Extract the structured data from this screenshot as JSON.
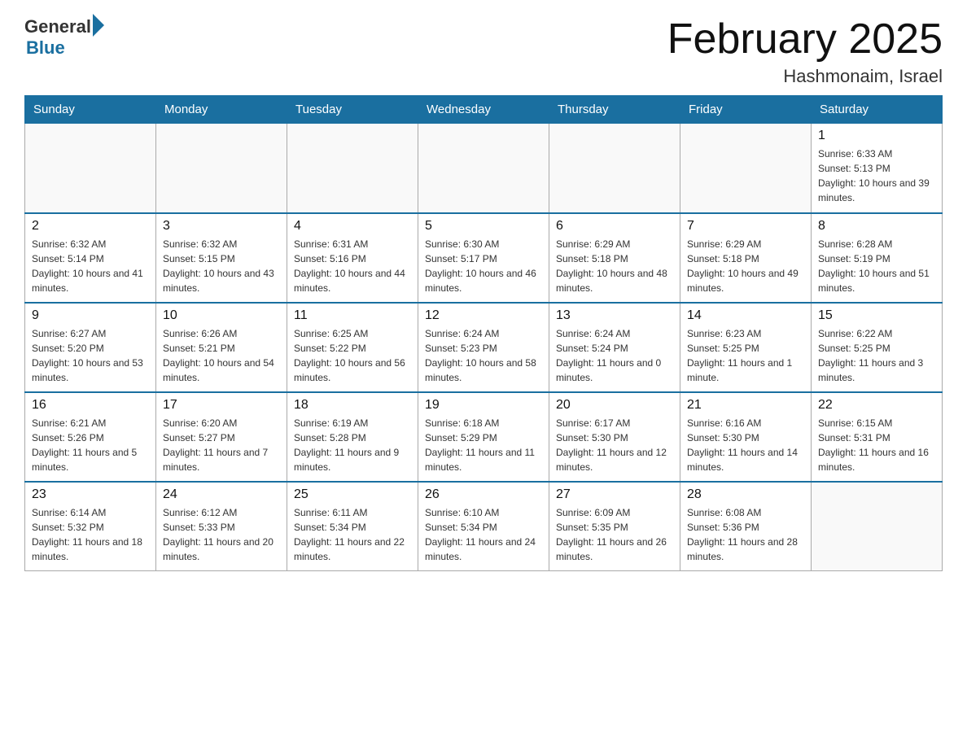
{
  "header": {
    "logo_general": "General",
    "logo_blue": "Blue",
    "month_title": "February 2025",
    "location": "Hashmonaim, Israel"
  },
  "weekdays": [
    "Sunday",
    "Monday",
    "Tuesday",
    "Wednesday",
    "Thursday",
    "Friday",
    "Saturday"
  ],
  "weeks": [
    [
      {
        "day": "",
        "sunrise": "",
        "sunset": "",
        "daylight": ""
      },
      {
        "day": "",
        "sunrise": "",
        "sunset": "",
        "daylight": ""
      },
      {
        "day": "",
        "sunrise": "",
        "sunset": "",
        "daylight": ""
      },
      {
        "day": "",
        "sunrise": "",
        "sunset": "",
        "daylight": ""
      },
      {
        "day": "",
        "sunrise": "",
        "sunset": "",
        "daylight": ""
      },
      {
        "day": "",
        "sunrise": "",
        "sunset": "",
        "daylight": ""
      },
      {
        "day": "1",
        "sunrise": "Sunrise: 6:33 AM",
        "sunset": "Sunset: 5:13 PM",
        "daylight": "Daylight: 10 hours and 39 minutes."
      }
    ],
    [
      {
        "day": "2",
        "sunrise": "Sunrise: 6:32 AM",
        "sunset": "Sunset: 5:14 PM",
        "daylight": "Daylight: 10 hours and 41 minutes."
      },
      {
        "day": "3",
        "sunrise": "Sunrise: 6:32 AM",
        "sunset": "Sunset: 5:15 PM",
        "daylight": "Daylight: 10 hours and 43 minutes."
      },
      {
        "day": "4",
        "sunrise": "Sunrise: 6:31 AM",
        "sunset": "Sunset: 5:16 PM",
        "daylight": "Daylight: 10 hours and 44 minutes."
      },
      {
        "day": "5",
        "sunrise": "Sunrise: 6:30 AM",
        "sunset": "Sunset: 5:17 PM",
        "daylight": "Daylight: 10 hours and 46 minutes."
      },
      {
        "day": "6",
        "sunrise": "Sunrise: 6:29 AM",
        "sunset": "Sunset: 5:18 PM",
        "daylight": "Daylight: 10 hours and 48 minutes."
      },
      {
        "day": "7",
        "sunrise": "Sunrise: 6:29 AM",
        "sunset": "Sunset: 5:18 PM",
        "daylight": "Daylight: 10 hours and 49 minutes."
      },
      {
        "day": "8",
        "sunrise": "Sunrise: 6:28 AM",
        "sunset": "Sunset: 5:19 PM",
        "daylight": "Daylight: 10 hours and 51 minutes."
      }
    ],
    [
      {
        "day": "9",
        "sunrise": "Sunrise: 6:27 AM",
        "sunset": "Sunset: 5:20 PM",
        "daylight": "Daylight: 10 hours and 53 minutes."
      },
      {
        "day": "10",
        "sunrise": "Sunrise: 6:26 AM",
        "sunset": "Sunset: 5:21 PM",
        "daylight": "Daylight: 10 hours and 54 minutes."
      },
      {
        "day": "11",
        "sunrise": "Sunrise: 6:25 AM",
        "sunset": "Sunset: 5:22 PM",
        "daylight": "Daylight: 10 hours and 56 minutes."
      },
      {
        "day": "12",
        "sunrise": "Sunrise: 6:24 AM",
        "sunset": "Sunset: 5:23 PM",
        "daylight": "Daylight: 10 hours and 58 minutes."
      },
      {
        "day": "13",
        "sunrise": "Sunrise: 6:24 AM",
        "sunset": "Sunset: 5:24 PM",
        "daylight": "Daylight: 11 hours and 0 minutes."
      },
      {
        "day": "14",
        "sunrise": "Sunrise: 6:23 AM",
        "sunset": "Sunset: 5:25 PM",
        "daylight": "Daylight: 11 hours and 1 minute."
      },
      {
        "day": "15",
        "sunrise": "Sunrise: 6:22 AM",
        "sunset": "Sunset: 5:25 PM",
        "daylight": "Daylight: 11 hours and 3 minutes."
      }
    ],
    [
      {
        "day": "16",
        "sunrise": "Sunrise: 6:21 AM",
        "sunset": "Sunset: 5:26 PM",
        "daylight": "Daylight: 11 hours and 5 minutes."
      },
      {
        "day": "17",
        "sunrise": "Sunrise: 6:20 AM",
        "sunset": "Sunset: 5:27 PM",
        "daylight": "Daylight: 11 hours and 7 minutes."
      },
      {
        "day": "18",
        "sunrise": "Sunrise: 6:19 AM",
        "sunset": "Sunset: 5:28 PM",
        "daylight": "Daylight: 11 hours and 9 minutes."
      },
      {
        "day": "19",
        "sunrise": "Sunrise: 6:18 AM",
        "sunset": "Sunset: 5:29 PM",
        "daylight": "Daylight: 11 hours and 11 minutes."
      },
      {
        "day": "20",
        "sunrise": "Sunrise: 6:17 AM",
        "sunset": "Sunset: 5:30 PM",
        "daylight": "Daylight: 11 hours and 12 minutes."
      },
      {
        "day": "21",
        "sunrise": "Sunrise: 6:16 AM",
        "sunset": "Sunset: 5:30 PM",
        "daylight": "Daylight: 11 hours and 14 minutes."
      },
      {
        "day": "22",
        "sunrise": "Sunrise: 6:15 AM",
        "sunset": "Sunset: 5:31 PM",
        "daylight": "Daylight: 11 hours and 16 minutes."
      }
    ],
    [
      {
        "day": "23",
        "sunrise": "Sunrise: 6:14 AM",
        "sunset": "Sunset: 5:32 PM",
        "daylight": "Daylight: 11 hours and 18 minutes."
      },
      {
        "day": "24",
        "sunrise": "Sunrise: 6:12 AM",
        "sunset": "Sunset: 5:33 PM",
        "daylight": "Daylight: 11 hours and 20 minutes."
      },
      {
        "day": "25",
        "sunrise": "Sunrise: 6:11 AM",
        "sunset": "Sunset: 5:34 PM",
        "daylight": "Daylight: 11 hours and 22 minutes."
      },
      {
        "day": "26",
        "sunrise": "Sunrise: 6:10 AM",
        "sunset": "Sunset: 5:34 PM",
        "daylight": "Daylight: 11 hours and 24 minutes."
      },
      {
        "day": "27",
        "sunrise": "Sunrise: 6:09 AM",
        "sunset": "Sunset: 5:35 PM",
        "daylight": "Daylight: 11 hours and 26 minutes."
      },
      {
        "day": "28",
        "sunrise": "Sunrise: 6:08 AM",
        "sunset": "Sunset: 5:36 PM",
        "daylight": "Daylight: 11 hours and 28 minutes."
      },
      {
        "day": "",
        "sunrise": "",
        "sunset": "",
        "daylight": ""
      }
    ]
  ]
}
